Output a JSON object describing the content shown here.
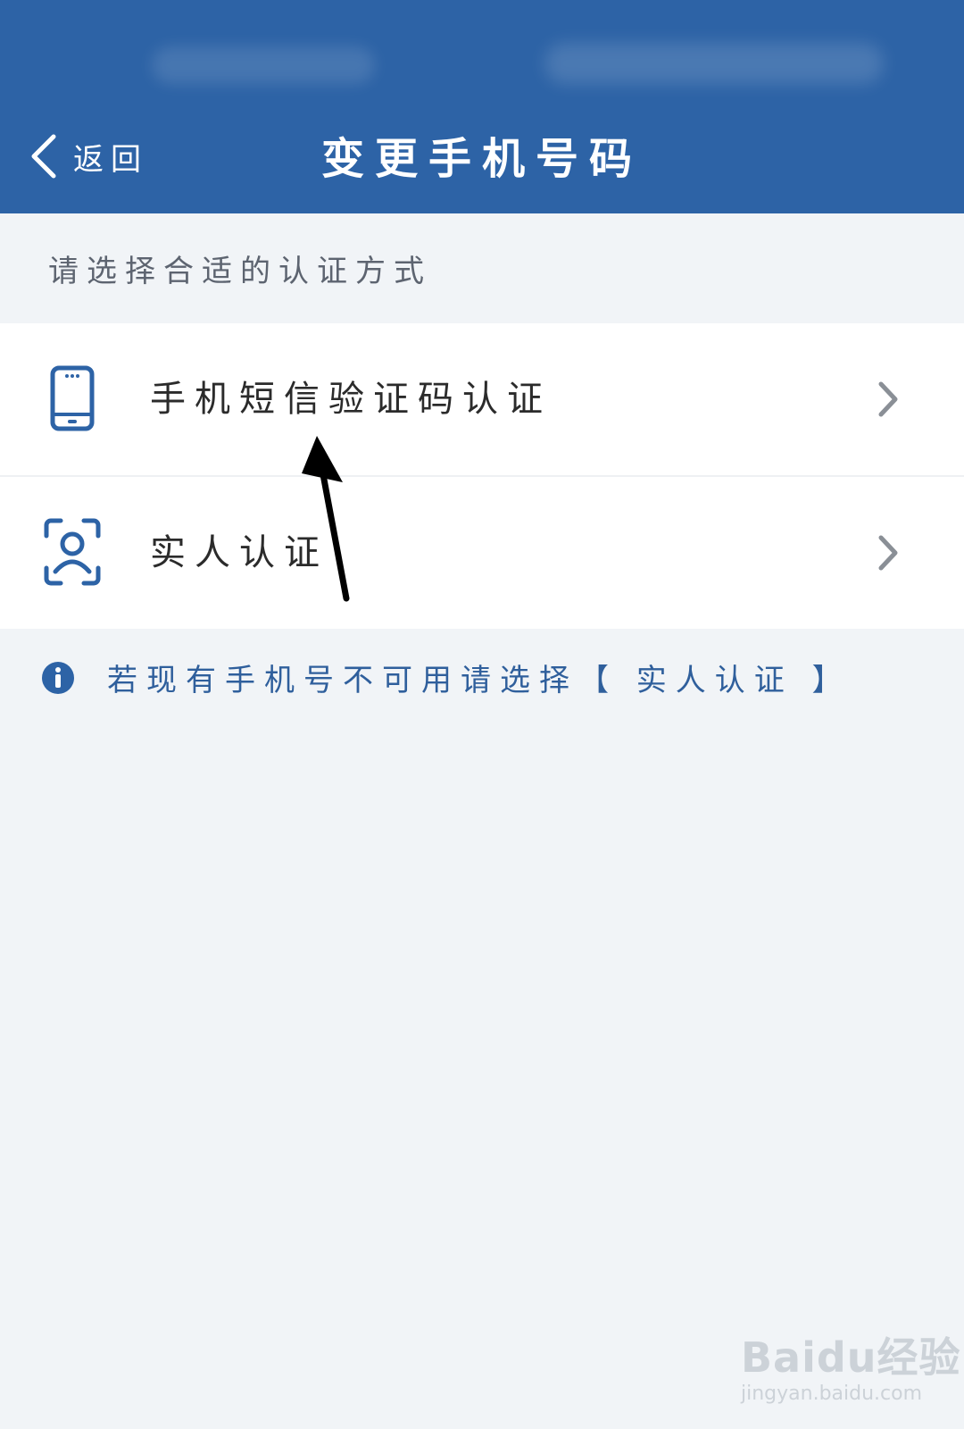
{
  "header": {
    "back_label": "返回",
    "title": "变更手机号码"
  },
  "prompt": "请选择合适的认证方式",
  "options": [
    {
      "label": "手机短信验证码认证",
      "icon": "phone-icon"
    },
    {
      "label": "实人认证",
      "icon": "face-scan-icon"
    }
  ],
  "notice": {
    "icon": "info-icon",
    "text": "若现有手机号不可用请选择【 实人认证 】"
  },
  "watermark": {
    "brand": "Baidu经验",
    "url": "jingyan.baidu.com"
  },
  "colors": {
    "header_bg": "#2d63a6",
    "page_bg": "#f1f4f7",
    "accent": "#2f5f9c"
  }
}
